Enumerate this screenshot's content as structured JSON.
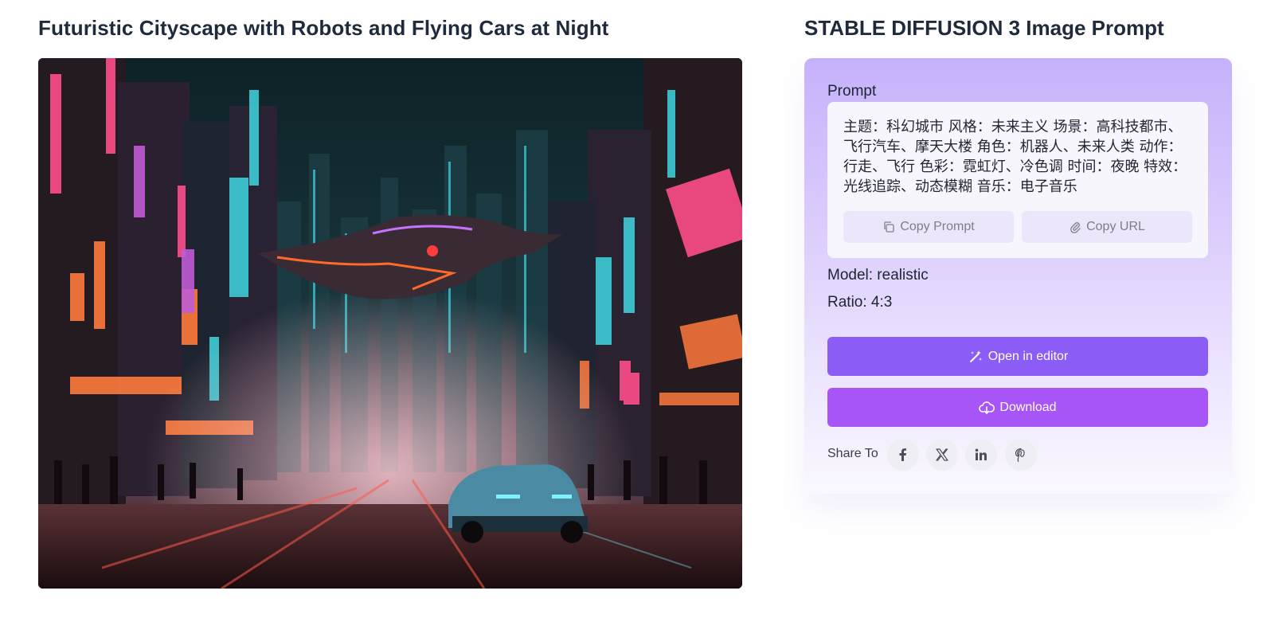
{
  "image_title": "Futuristic Cityscape with Robots and Flying Cars at Night",
  "panel_title": "STABLE DIFFUSION 3 Image Prompt",
  "prompt": {
    "label": "Prompt",
    "text": "主题：科幻城市 风格：未来主义 场景：高科技都市、飞行汽车、摩天大楼 角色：机器人、未来人类 动作：行走、飞行 色彩：霓虹灯、冷色调 时间：夜晚 特效：光线追踪、动态模糊 音乐：电子音乐",
    "copy_prompt_label": "Copy Prompt",
    "copy_url_label": "Copy URL"
  },
  "meta": {
    "model": "Model: realistic",
    "ratio": "Ratio: 4:3"
  },
  "actions": {
    "open_editor_label": "Open in editor",
    "download_label": "Download"
  },
  "share": {
    "label": "Share To",
    "icons": [
      "facebook-icon",
      "x-icon",
      "linkedin-icon",
      "pinterest-icon"
    ]
  },
  "colors": {
    "primary": "#8b5cf6",
    "secondary": "#a855f7",
    "panel_top": "#c6b1fb"
  }
}
